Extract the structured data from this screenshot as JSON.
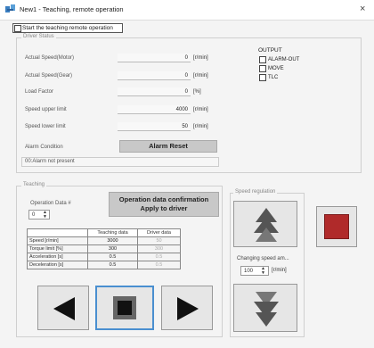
{
  "window": {
    "title": "New1 - Teaching, remote operation",
    "close_glyph": "×"
  },
  "start_teaching": {
    "label": "Start the teaching remote operation",
    "checked": false
  },
  "driver_status": {
    "group_title": "Driver Status",
    "rows": [
      {
        "label": "Actual Speed(Motor)",
        "value": "0",
        "unit": "[r/min]"
      },
      {
        "label": "Actual Speed(Gear)",
        "value": "0",
        "unit": "[r/min]"
      },
      {
        "label": "Load Factor",
        "value": "0",
        "unit": "[%]"
      },
      {
        "label": "Speed upper limit",
        "value": "4000",
        "unit": "[r/min]"
      },
      {
        "label": "Speed lower limit",
        "value": "50",
        "unit": "[r/min]"
      }
    ],
    "alarm_condition_label": "Alarm Condition",
    "alarm_reset_label": "Alarm Reset",
    "alarm_message": "00:Alarm not present"
  },
  "output": {
    "title": "OUTPUT",
    "items": [
      {
        "label": "ALARM-OUT",
        "checked": false
      },
      {
        "label": "MOVE",
        "checked": false
      },
      {
        "label": "TLC",
        "checked": false
      }
    ]
  },
  "teaching": {
    "group_title": "Teaching",
    "op_data_label": "Operation Data #",
    "op_data_value": "0",
    "confirm_button": {
      "line1": "Operation data confirmation",
      "line2": "Apply to driver"
    },
    "table": {
      "col_headers": [
        "",
        "Teaching data",
        "Driver data"
      ],
      "rows": [
        {
          "label": "Speed [r/min]",
          "teaching": "3000",
          "driver": "50"
        },
        {
          "label": "Torque limit [%]",
          "teaching": "300",
          "driver": "300"
        },
        {
          "label": "Acceleration [s]",
          "teaching": "0.5",
          "driver": "0.5"
        },
        {
          "label": "Deceleration [s]",
          "teaching": "0.5",
          "driver": "0.5"
        }
      ]
    }
  },
  "speed_regulation": {
    "group_title": "Speed regulation",
    "changing_label": "Changing speed am...",
    "changing_value": "100",
    "changing_unit": "[r/min]"
  },
  "colors": {
    "stop_red": "#b02a2a",
    "arrow_gray": "#5a5a5a",
    "button_gray": "#c8c8c8"
  },
  "icons": {
    "left": "triangle-left-icon",
    "right": "triangle-right-icon",
    "stop": "square-stop-icon",
    "speed_up": "double-chevron-up-icon",
    "speed_down": "double-chevron-down-icon",
    "red_stop": "red-square-icon"
  }
}
